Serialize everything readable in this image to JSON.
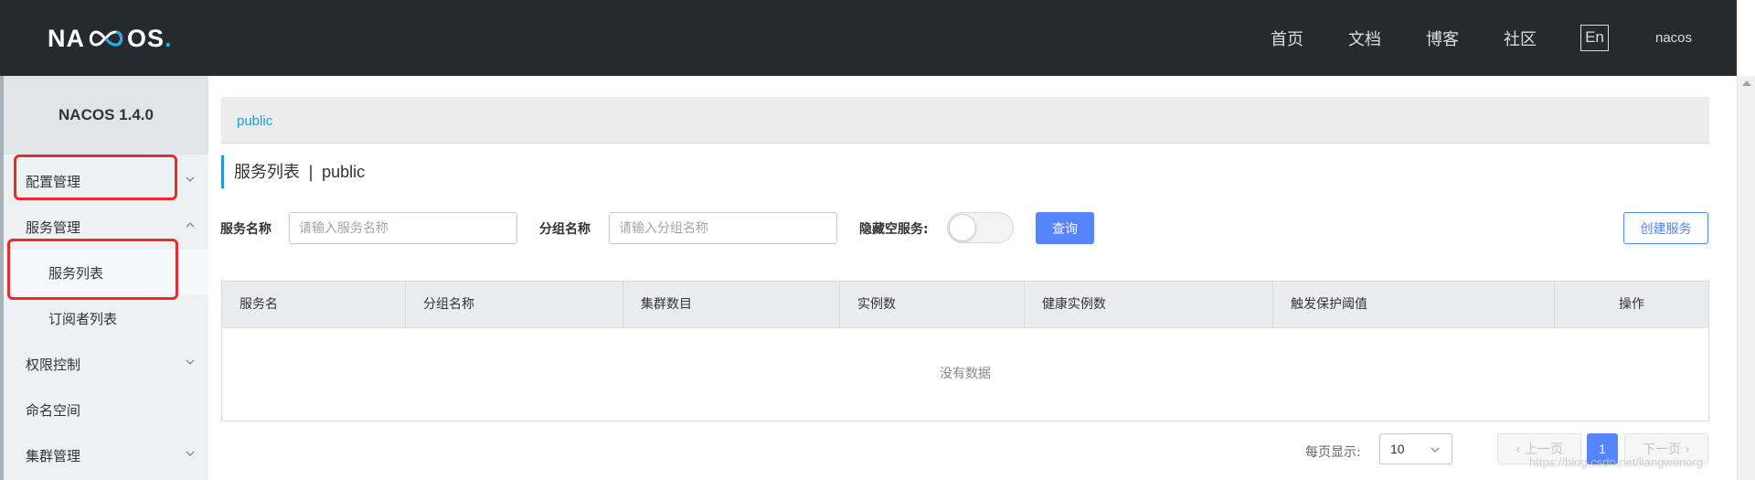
{
  "header": {
    "logo_text_left": "NA",
    "logo_text_right": "OS",
    "logo_dot": ".",
    "nav": [
      "首页",
      "文档",
      "博客",
      "社区"
    ],
    "lang": "En",
    "user": "nacos"
  },
  "sidebar": {
    "title": "NACOS 1.4.0",
    "items": [
      {
        "label": "配置管理",
        "chevron": "down"
      },
      {
        "label": "服务管理",
        "chevron": "up"
      },
      {
        "label": "服务列表"
      },
      {
        "label": "订阅者列表"
      },
      {
        "label": "权限控制",
        "chevron": "down"
      },
      {
        "label": "命名空间"
      },
      {
        "label": "集群管理",
        "chevron": "down"
      }
    ]
  },
  "breadcrumb": "public",
  "page_title": {
    "main": "服务列表",
    "sep": "|",
    "namespace": "public"
  },
  "filters": {
    "service_name_label": "服务名称",
    "service_name_placeholder": "请输入服务名称",
    "group_name_label": "分组名称",
    "group_name_placeholder": "请输入分组名称",
    "hide_empty_label": "隐藏空服务:",
    "hide_empty_on": false,
    "query_button": "查询",
    "create_button": "创建服务"
  },
  "table": {
    "columns": [
      "服务名",
      "分组名称",
      "集群数目",
      "实例数",
      "健康实例数",
      "触发保护阈值",
      "操作"
    ],
    "empty_text": "没有数据"
  },
  "pagination": {
    "per_page_label": "每页显示:",
    "per_page_value": "10",
    "prev": "上一页",
    "current": "1",
    "next": "下一页"
  },
  "watermark": "https://blog.csdn.net/liangwenorg",
  "colors": {
    "accent": "#5584ff",
    "header_bg": "#252a2f",
    "breadcrumb_link": "#1c9fd6",
    "highlight": "#ea2b2b"
  }
}
